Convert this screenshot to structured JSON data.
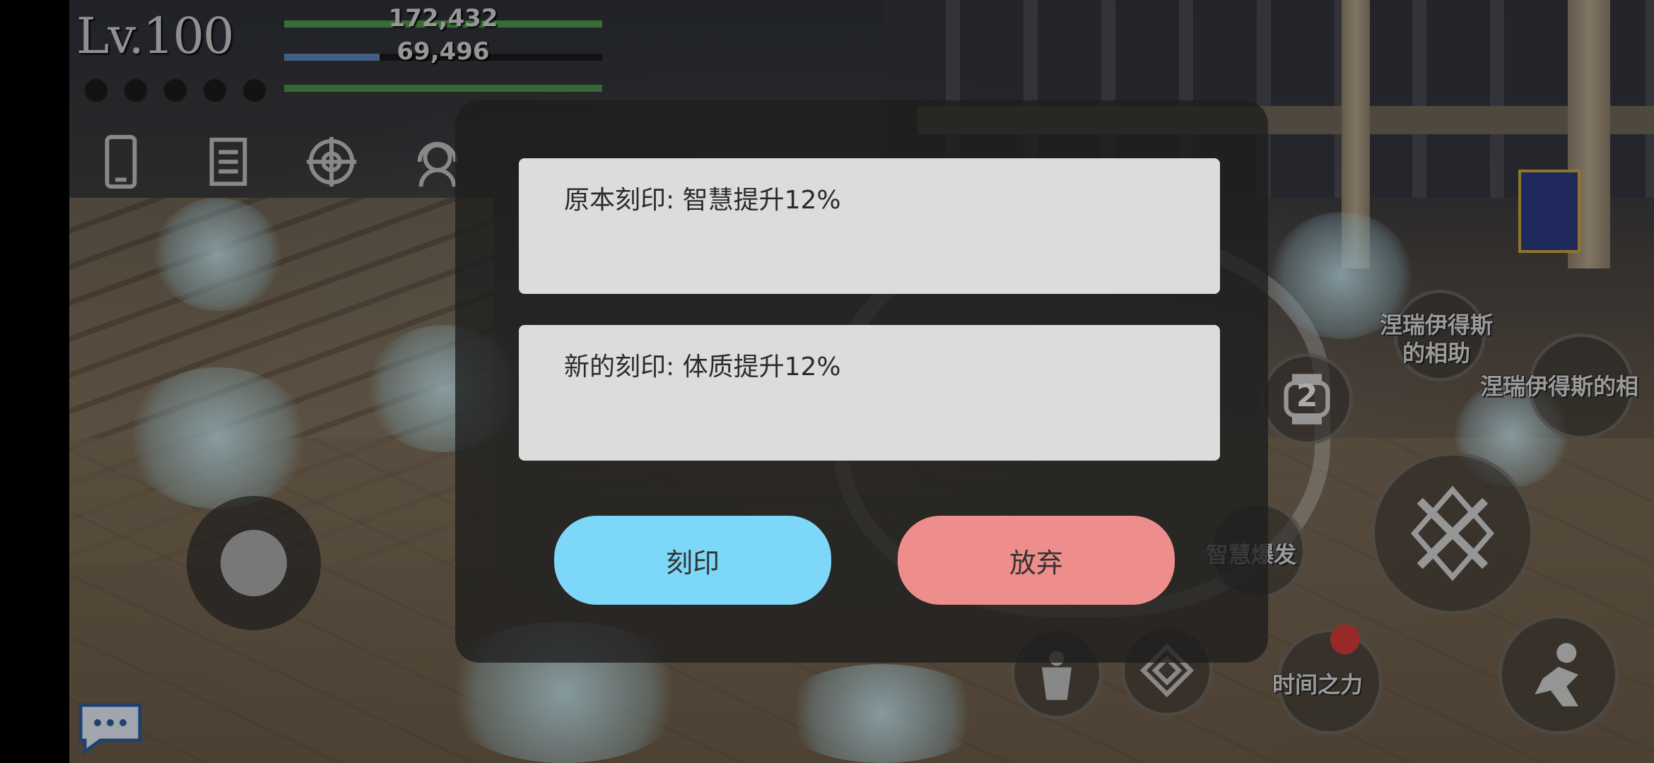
{
  "hud": {
    "level": "Lv.100",
    "hp_value": "172,432",
    "mp_value": "69,496",
    "mp_fraction": 0.3
  },
  "skills": {
    "nerias_aid": "涅瑞伊得斯\n的相助",
    "nerias_aid_2": "涅瑞伊得斯的相",
    "wisdom_burst": "智慧爆发",
    "power_of_time": "时间之力",
    "watch_count": "2"
  },
  "dialog": {
    "original_imprint": "原本刻印: 智慧提升12%",
    "new_imprint": "新的刻印: 体质提升12%",
    "imprint_button": "刻印",
    "discard_button": "放弃"
  },
  "colors": {
    "imprint_button": "#7dd7f8",
    "discard_button": "#ee8e8c",
    "hp_bar": "#4f9a4a",
    "mp_bar": "#5a86b8"
  }
}
